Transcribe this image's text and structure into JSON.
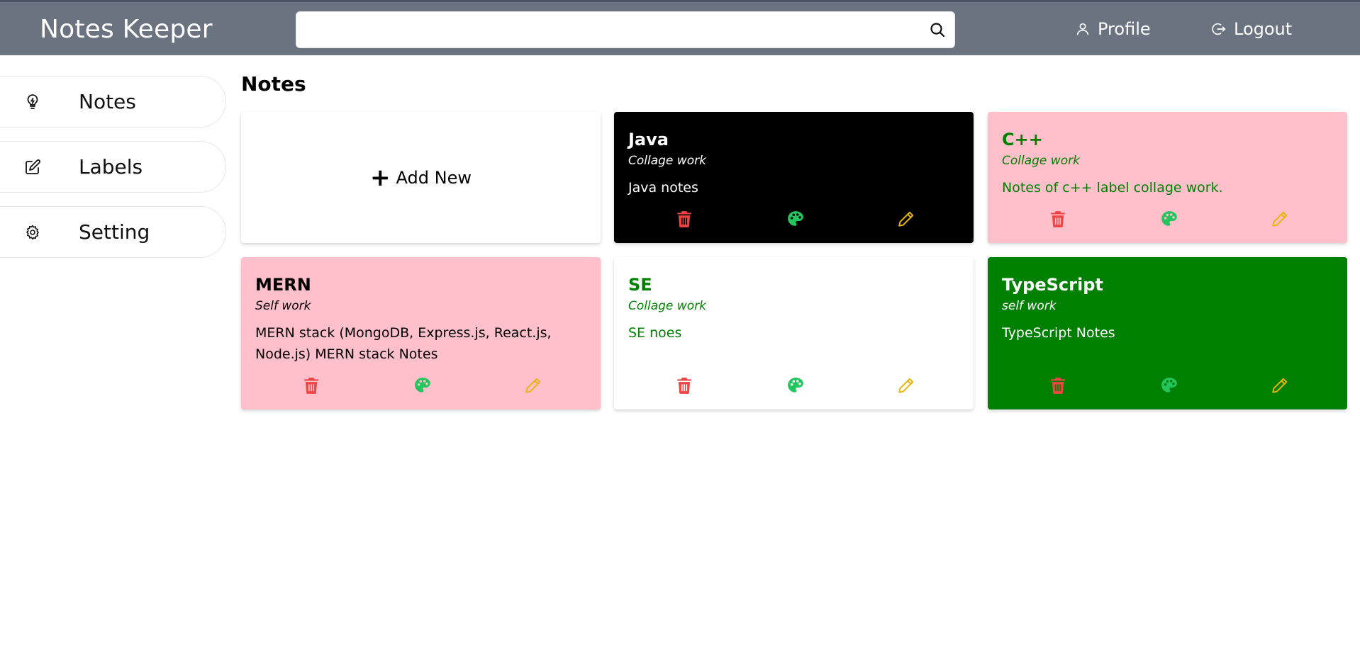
{
  "app": {
    "title": "Notes Keeper"
  },
  "search": {
    "placeholder": "",
    "value": ""
  },
  "header": {
    "profile_label": "Profile",
    "logout_label": "Logout"
  },
  "sidebar": {
    "items": [
      {
        "label": "Notes",
        "icon": "lightbulb-icon"
      },
      {
        "label": "Labels",
        "icon": "edit-icon"
      },
      {
        "label": "Setting",
        "icon": "gear-icon"
      }
    ]
  },
  "main": {
    "title": "Notes",
    "add_new_label": "Add New",
    "notes": [
      {
        "title": "Java",
        "label": "Collage work",
        "content": "Java notes",
        "bg_color": "#000000",
        "text_color": "#ffffff"
      },
      {
        "title": "C++",
        "label": "Collage work",
        "content": "Notes of c++ label collage work.",
        "bg_color": "#ffc0cb",
        "text_color": "#008000"
      },
      {
        "title": "MERN",
        "label": "Self work",
        "content": "MERN stack (MongoDB, Express.js, React.js, Node.js) MERN stack Notes",
        "bg_color": "#ffc0cb",
        "text_color": "#000000"
      },
      {
        "title": "SE",
        "label": "Collage work",
        "content": "SE noes",
        "bg_color": "#ffffff",
        "text_color": "#008000"
      },
      {
        "title": "TypeScript",
        "label": "self work",
        "content": "TypeScript Notes",
        "bg_color": "#008000",
        "text_color": "#ffffff"
      }
    ]
  },
  "colors": {
    "topbar": "#6b7280",
    "delete": "#ef4444",
    "palette": "#22c55e",
    "edit": "#eab308"
  }
}
